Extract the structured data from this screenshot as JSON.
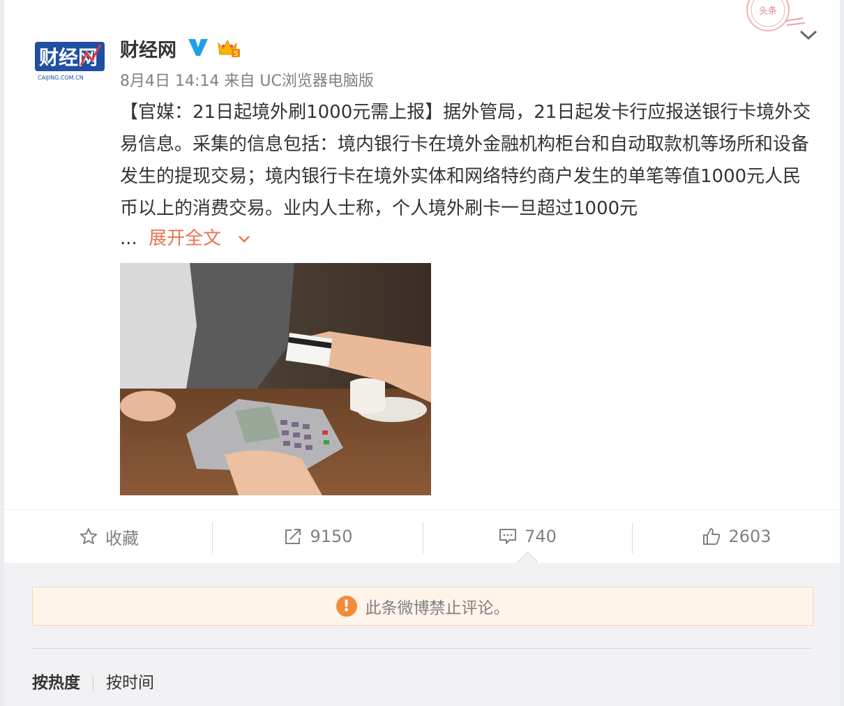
{
  "author": {
    "name": "财经网",
    "avatar_text": "财经网",
    "avatar_subtext": "CAIJING.COM.CN",
    "level_badge": "5"
  },
  "meta": {
    "date": "8月4日 14:14",
    "source_prefix": "来自",
    "source": "UC浏览器电脑版"
  },
  "stamp_text": "头条",
  "post": {
    "text": "【官媒：21日起境外刷1000元需上报】据外管局，21日起发卡行应报送银行卡境外交易信息。采集的信息包括：境内银行卡在境外金融机构柜台和自动取款机等场所和设备发生的提现交易；境内银行卡在境外实体和网络特约商户发生的单笔等值1000元人民币以上的消费交易。业内人士称，个人境外刷卡一旦超过1000元",
    "ellipsis": "...",
    "expand_label": "展开全文"
  },
  "actions": {
    "favorite_label": "收藏",
    "repost_count": "9150",
    "comment_count": "740",
    "like_count": "2603"
  },
  "notice": {
    "icon": "!",
    "text": "此条微博禁止评论。"
  },
  "sort": {
    "hot_label": "按热度",
    "time_label": "按时间"
  },
  "colors": {
    "accent": "#eb7350",
    "verified": "#1ba1e6",
    "notice_bg": "#fff4ea",
    "notice_icon": "#f28b3a"
  }
}
